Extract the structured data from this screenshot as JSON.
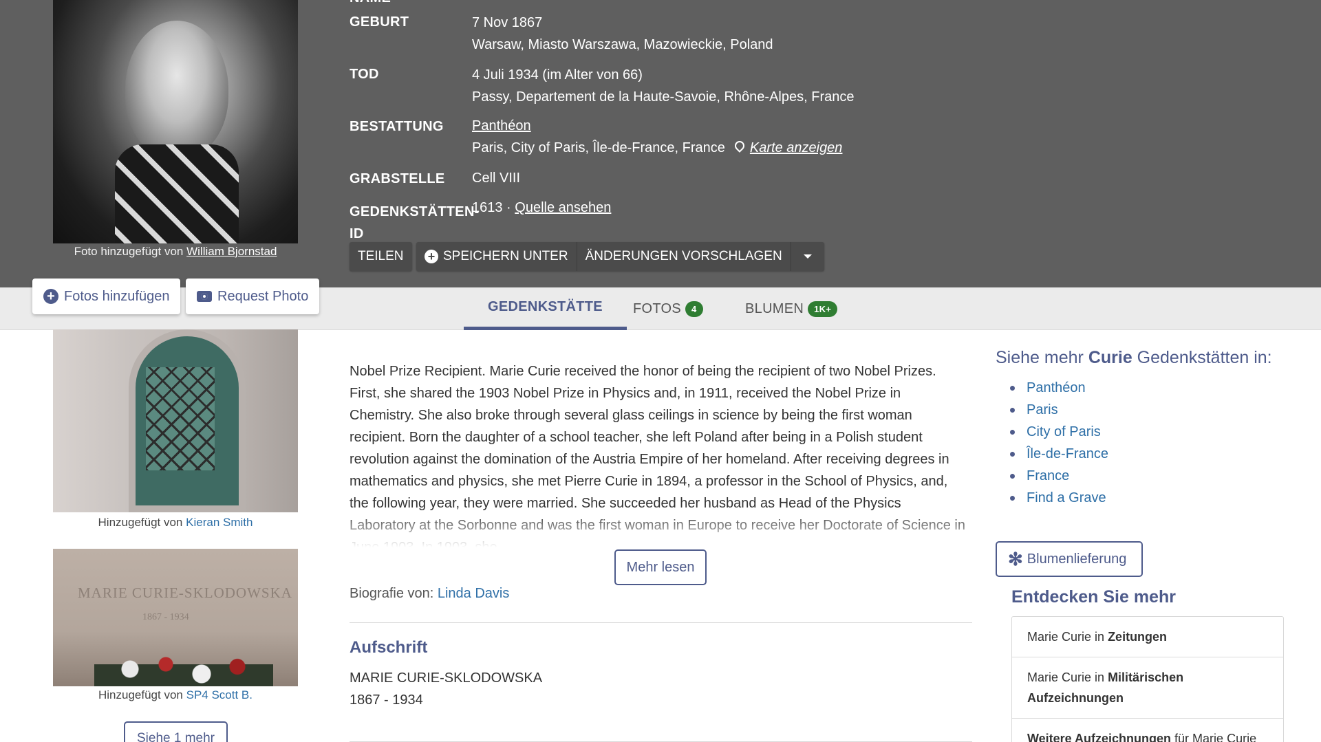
{
  "main_photo": {
    "caption_prefix": "Foto hinzugefügt von",
    "caption_author": "William Bjornstad"
  },
  "facts": {
    "name_label": "NAME",
    "birth_label": "GEBURT",
    "birth_date": "7 Nov 1867",
    "birth_place": "Warsaw, Miasto Warszawa, Mazowieckie, Poland",
    "death_label": "TOD",
    "death_date": "4 Juli 1934 (im Alter von 66)",
    "death_place": "Passy, Departement de la Haute-Savoie, Rhône-Alpes, France",
    "burial_label": "BESTATTUNG",
    "burial_cemetery": "Panthéon",
    "burial_place": "Paris, City of Paris, Île-de-France, France",
    "map_link": "Karte anzeigen",
    "plot_label": "GRABSTELLE",
    "plot_value": "Cell VIII",
    "memorial_id_label_1": "GEDENKSTÄTTEN-",
    "memorial_id_label_2": "ID",
    "memorial_id": "1613 ·",
    "source_link": "Quelle ansehen"
  },
  "actions": {
    "share": "TEILEN",
    "save_to": "SPEICHERN UNTER",
    "suggest_edits": "ÄNDERUNGEN VORSCHLAGEN"
  },
  "photo_buttons": {
    "add_photos": "Fotos hinzufügen",
    "request_photo": "Request Photo"
  },
  "tabs": [
    {
      "label": "GEDENKSTÄTTE",
      "active": true
    },
    {
      "label": "FOTOS",
      "badge": "4"
    },
    {
      "label": "BLUMEN",
      "badge": "1K+"
    }
  ],
  "thumbnails": [
    {
      "prefix": "Hinzugefügt von",
      "author": "Kieran Smith"
    },
    {
      "prefix": "Hinzugefügt von",
      "author": "SP4 Scott B.",
      "engraving": "MARIE CURIE-SKLODOWSKA",
      "engraving_years": "1867 - 1934"
    }
  ],
  "see_more_photos": "Siehe 1 mehr",
  "bio": {
    "text": "Nobel Prize Recipient. Marie Curie received the honor of being the recipient of two Nobel Prizes. First, she shared the 1903 Nobel Prize in Physics and, in 1911, received the Nobel Prize in Chemistry. She also broke through several glass ceilings in science by being the first woman recipient. Born the daughter of a school teacher, she left Poland after being in a Polish student revolution against the domination of the Austria Empire of her homeland. After receiving degrees in mathematics and physics, she met Pierre Curie in 1894, a professor in the School of Physics, and, the following year, they were married. She succeeded her husband as Head of the Physics Laboratory at the Sorbonne and was the first woman in Europe to receive her Doctorate of Science in June 1903. In 1903, she",
    "read_more": "Mehr lesen",
    "by_label": "Biografie von:",
    "by_author": "Linda Davis"
  },
  "inscription": {
    "title": "Aufschrift",
    "line1": "MARIE CURIE-SKLODOWSKA",
    "line2": "1867 - 1934"
  },
  "sidebar": {
    "see_more_prefix": "Siehe mehr",
    "see_more_name": "Curie",
    "see_more_suffix": "Gedenkstätten in:",
    "locations": [
      "Panthéon",
      "Paris",
      "City of Paris",
      "Île-de-France",
      "France",
      "Find a Grave"
    ],
    "flower_delivery": "Blumenlieferung",
    "discover_title": "Entdecken Sie mehr",
    "discover_items": [
      {
        "pre": "Marie Curie in",
        "bold": "Zeitungen"
      },
      {
        "pre": "Marie Curie in",
        "bold": "Militärischen Aufzeichnungen"
      },
      {
        "bold": "Weitere Aufzeichnungen",
        "post": "für Marie Curie"
      }
    ]
  },
  "colors": {
    "hero_bg": "#5f5f5f",
    "accent": "#4e5b8b",
    "link": "#2e6fa7",
    "badge_green": "#2f7d32"
  }
}
